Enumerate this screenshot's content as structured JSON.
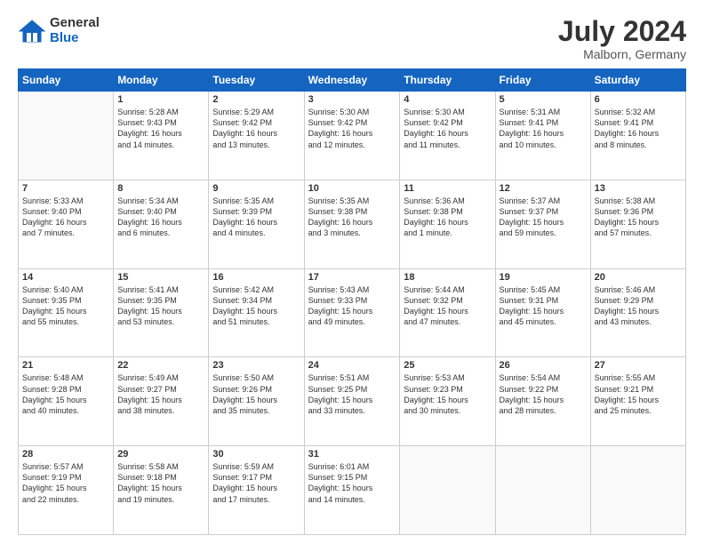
{
  "logo": {
    "general": "General",
    "blue": "Blue"
  },
  "header": {
    "month_year": "July 2024",
    "location": "Malborn, Germany"
  },
  "weekdays": [
    "Sunday",
    "Monday",
    "Tuesday",
    "Wednesday",
    "Thursday",
    "Friday",
    "Saturday"
  ],
  "weeks": [
    [
      {
        "day": "",
        "info": ""
      },
      {
        "day": "1",
        "info": "Sunrise: 5:28 AM\nSunset: 9:43 PM\nDaylight: 16 hours\nand 14 minutes."
      },
      {
        "day": "2",
        "info": "Sunrise: 5:29 AM\nSunset: 9:42 PM\nDaylight: 16 hours\nand 13 minutes."
      },
      {
        "day": "3",
        "info": "Sunrise: 5:30 AM\nSunset: 9:42 PM\nDaylight: 16 hours\nand 12 minutes."
      },
      {
        "day": "4",
        "info": "Sunrise: 5:30 AM\nSunset: 9:42 PM\nDaylight: 16 hours\nand 11 minutes."
      },
      {
        "day": "5",
        "info": "Sunrise: 5:31 AM\nSunset: 9:41 PM\nDaylight: 16 hours\nand 10 minutes."
      },
      {
        "day": "6",
        "info": "Sunrise: 5:32 AM\nSunset: 9:41 PM\nDaylight: 16 hours\nand 8 minutes."
      }
    ],
    [
      {
        "day": "7",
        "info": "Sunrise: 5:33 AM\nSunset: 9:40 PM\nDaylight: 16 hours\nand 7 minutes."
      },
      {
        "day": "8",
        "info": "Sunrise: 5:34 AM\nSunset: 9:40 PM\nDaylight: 16 hours\nand 6 minutes."
      },
      {
        "day": "9",
        "info": "Sunrise: 5:35 AM\nSunset: 9:39 PM\nDaylight: 16 hours\nand 4 minutes."
      },
      {
        "day": "10",
        "info": "Sunrise: 5:35 AM\nSunset: 9:38 PM\nDaylight: 16 hours\nand 3 minutes."
      },
      {
        "day": "11",
        "info": "Sunrise: 5:36 AM\nSunset: 9:38 PM\nDaylight: 16 hours\nand 1 minute."
      },
      {
        "day": "12",
        "info": "Sunrise: 5:37 AM\nSunset: 9:37 PM\nDaylight: 15 hours\nand 59 minutes."
      },
      {
        "day": "13",
        "info": "Sunrise: 5:38 AM\nSunset: 9:36 PM\nDaylight: 15 hours\nand 57 minutes."
      }
    ],
    [
      {
        "day": "14",
        "info": "Sunrise: 5:40 AM\nSunset: 9:35 PM\nDaylight: 15 hours\nand 55 minutes."
      },
      {
        "day": "15",
        "info": "Sunrise: 5:41 AM\nSunset: 9:35 PM\nDaylight: 15 hours\nand 53 minutes."
      },
      {
        "day": "16",
        "info": "Sunrise: 5:42 AM\nSunset: 9:34 PM\nDaylight: 15 hours\nand 51 minutes."
      },
      {
        "day": "17",
        "info": "Sunrise: 5:43 AM\nSunset: 9:33 PM\nDaylight: 15 hours\nand 49 minutes."
      },
      {
        "day": "18",
        "info": "Sunrise: 5:44 AM\nSunset: 9:32 PM\nDaylight: 15 hours\nand 47 minutes."
      },
      {
        "day": "19",
        "info": "Sunrise: 5:45 AM\nSunset: 9:31 PM\nDaylight: 15 hours\nand 45 minutes."
      },
      {
        "day": "20",
        "info": "Sunrise: 5:46 AM\nSunset: 9:29 PM\nDaylight: 15 hours\nand 43 minutes."
      }
    ],
    [
      {
        "day": "21",
        "info": "Sunrise: 5:48 AM\nSunset: 9:28 PM\nDaylight: 15 hours\nand 40 minutes."
      },
      {
        "day": "22",
        "info": "Sunrise: 5:49 AM\nSunset: 9:27 PM\nDaylight: 15 hours\nand 38 minutes."
      },
      {
        "day": "23",
        "info": "Sunrise: 5:50 AM\nSunset: 9:26 PM\nDaylight: 15 hours\nand 35 minutes."
      },
      {
        "day": "24",
        "info": "Sunrise: 5:51 AM\nSunset: 9:25 PM\nDaylight: 15 hours\nand 33 minutes."
      },
      {
        "day": "25",
        "info": "Sunrise: 5:53 AM\nSunset: 9:23 PM\nDaylight: 15 hours\nand 30 minutes."
      },
      {
        "day": "26",
        "info": "Sunrise: 5:54 AM\nSunset: 9:22 PM\nDaylight: 15 hours\nand 28 minutes."
      },
      {
        "day": "27",
        "info": "Sunrise: 5:55 AM\nSunset: 9:21 PM\nDaylight: 15 hours\nand 25 minutes."
      }
    ],
    [
      {
        "day": "28",
        "info": "Sunrise: 5:57 AM\nSunset: 9:19 PM\nDaylight: 15 hours\nand 22 minutes."
      },
      {
        "day": "29",
        "info": "Sunrise: 5:58 AM\nSunset: 9:18 PM\nDaylight: 15 hours\nand 19 minutes."
      },
      {
        "day": "30",
        "info": "Sunrise: 5:59 AM\nSunset: 9:17 PM\nDaylight: 15 hours\nand 17 minutes."
      },
      {
        "day": "31",
        "info": "Sunrise: 6:01 AM\nSunset: 9:15 PM\nDaylight: 15 hours\nand 14 minutes."
      },
      {
        "day": "",
        "info": ""
      },
      {
        "day": "",
        "info": ""
      },
      {
        "day": "",
        "info": ""
      }
    ]
  ]
}
